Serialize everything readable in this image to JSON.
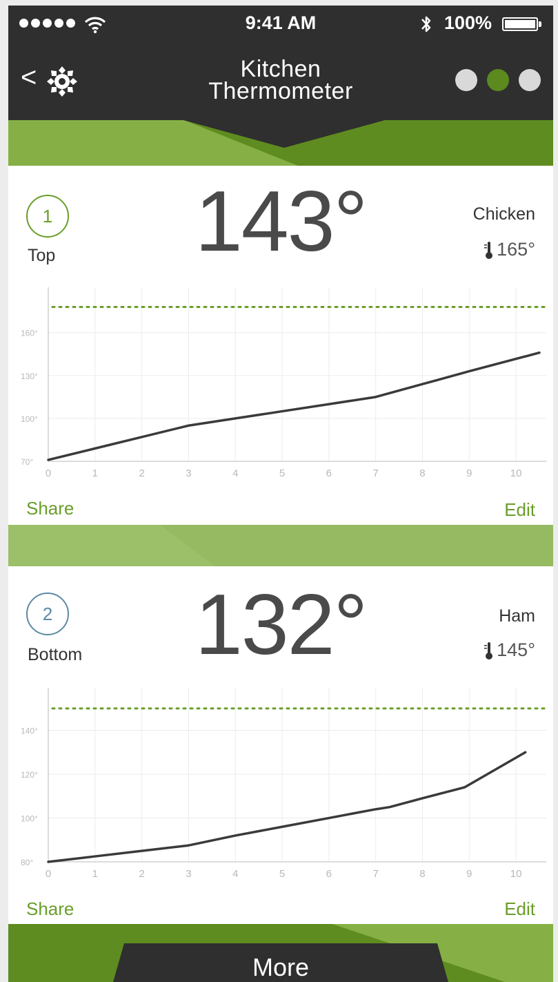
{
  "status_bar": {
    "time": "9:41 AM",
    "battery_percent": "100%",
    "signal_bars": 5,
    "icons": [
      "signal-dots-icon",
      "wifi-icon",
      "bluetooth-icon",
      "battery-icon"
    ]
  },
  "header": {
    "back_label": "<",
    "title_line1": "Kitchen",
    "title_line2": "Thermometer",
    "page_dots": 3,
    "active_dot": 2
  },
  "colors": {
    "header_bg": "#2f2f2f",
    "accent_green": "#5c8a1e",
    "probe2_blue": "#5b8aa3",
    "line_color": "#3a3a3a",
    "target_line": "#6a9d2a"
  },
  "probes": [
    {
      "number": "1",
      "position": "Top",
      "temperature": "143°",
      "food": "Chicken",
      "target": "165°",
      "share_label": "Share",
      "edit_label": "Edit"
    },
    {
      "number": "2",
      "position": "Bottom",
      "temperature": "132°",
      "food": "Ham",
      "target": "145°",
      "share_label": "Share",
      "edit_label": "Edit"
    }
  ],
  "chart_data": [
    {
      "type": "line",
      "x_ticks": [
        0,
        1,
        2,
        3,
        4,
        5,
        6,
        7,
        8,
        9,
        10
      ],
      "y_ticks": [
        "70°",
        "100°",
        "130°",
        "160°"
      ],
      "y_tick_values": [
        70,
        100,
        130,
        160
      ],
      "xlim": [
        0,
        10.5
      ],
      "ylim": [
        70,
        185
      ],
      "target_value": 178,
      "series": [
        {
          "x": [
            0,
            1,
            2,
            3,
            4,
            5,
            6,
            7,
            8,
            9,
            10.5
          ],
          "values": [
            71,
            79,
            87,
            95,
            100,
            105,
            110,
            115,
            124,
            133,
            146
          ]
        }
      ],
      "grid": true
    },
    {
      "type": "line",
      "x_ticks": [
        0,
        1,
        2,
        3,
        4,
        5,
        6,
        7,
        8,
        9,
        10
      ],
      "y_ticks": [
        "80°",
        "100°",
        "120°",
        "140°"
      ],
      "y_tick_values": [
        80,
        100,
        120,
        140
      ],
      "xlim": [
        0,
        10.5
      ],
      "ylim": [
        80,
        155
      ],
      "target_value": 150,
      "series": [
        {
          "x": [
            0,
            1,
            2,
            3,
            4,
            5,
            6,
            7,
            7.3,
            8,
            8.9,
            10.2
          ],
          "values": [
            80,
            82.5,
            85,
            87.5,
            92,
            96,
            100,
            104,
            105,
            109,
            114,
            130
          ]
        }
      ],
      "grid": true
    }
  ],
  "footer": {
    "more_label": "More"
  }
}
